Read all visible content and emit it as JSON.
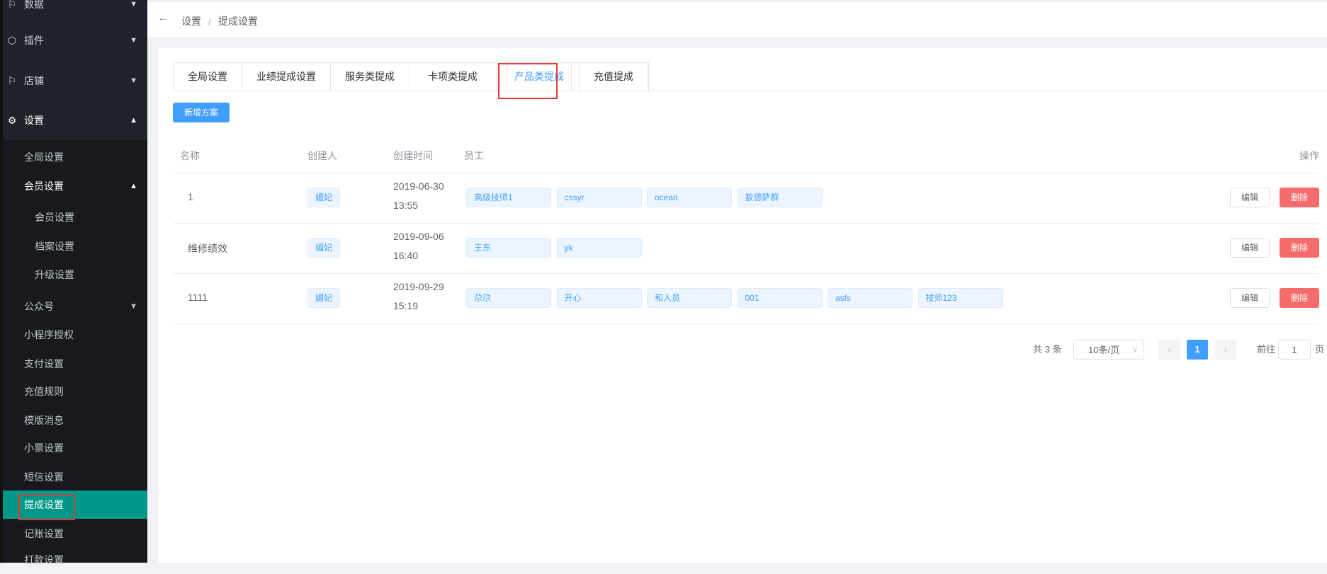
{
  "sidebar": {
    "top": [
      {
        "label": "数据"
      },
      {
        "label": "插件"
      },
      {
        "label": "店铺"
      },
      {
        "label": "设置"
      }
    ],
    "items": [
      "全局设置",
      "会员设置",
      "会员设置",
      "档案设置",
      "升级设置",
      "公众号",
      "小程序授权",
      "支付设置",
      "充值规则",
      "模版消息",
      "小票设置",
      "短信设置",
      "提成设置",
      "记账设置",
      "打款设置"
    ]
  },
  "breadcrumb": {
    "root": "设置",
    "sep": "/",
    "current": "提成设置"
  },
  "tabs": [
    "全局设置",
    "业绩提成设置",
    "服务类提成",
    "卡项类提成",
    "产品类提成",
    "充值提成"
  ],
  "add_button": "新增方案",
  "table": {
    "headers": {
      "name": "名称",
      "creator": "创建人",
      "time": "创建时间",
      "staff": "员工",
      "ops": "操作"
    },
    "rows": [
      {
        "name": "1",
        "creator": "媚妃",
        "date": "2019-06-30",
        "time": "13:55",
        "staff": [
          "高级技师1",
          "cssyr",
          "ocean",
          "敖德萨群"
        ]
      },
      {
        "name": "维修绩效",
        "creator": "媚妃",
        "date": "2019-09-06",
        "time": "16:40",
        "staff": [
          "王东",
          "yk"
        ]
      },
      {
        "name": "1111",
        "creator": "媚妃",
        "date": "2019-09-29",
        "time": "15:19",
        "staff": [
          "尕尕",
          "开心",
          "和人员",
          "001",
          "asfs",
          "技师123"
        ]
      }
    ],
    "edit": "编辑",
    "delete": "删除"
  },
  "pagination": {
    "total": "共 3 条",
    "size": "10条/页",
    "page": "1",
    "goto": "前往",
    "goto_value": "1",
    "page_suffix": "页"
  },
  "colors": {
    "accent": "#409eff",
    "active": "#009688",
    "danger": "#f56c6c"
  }
}
